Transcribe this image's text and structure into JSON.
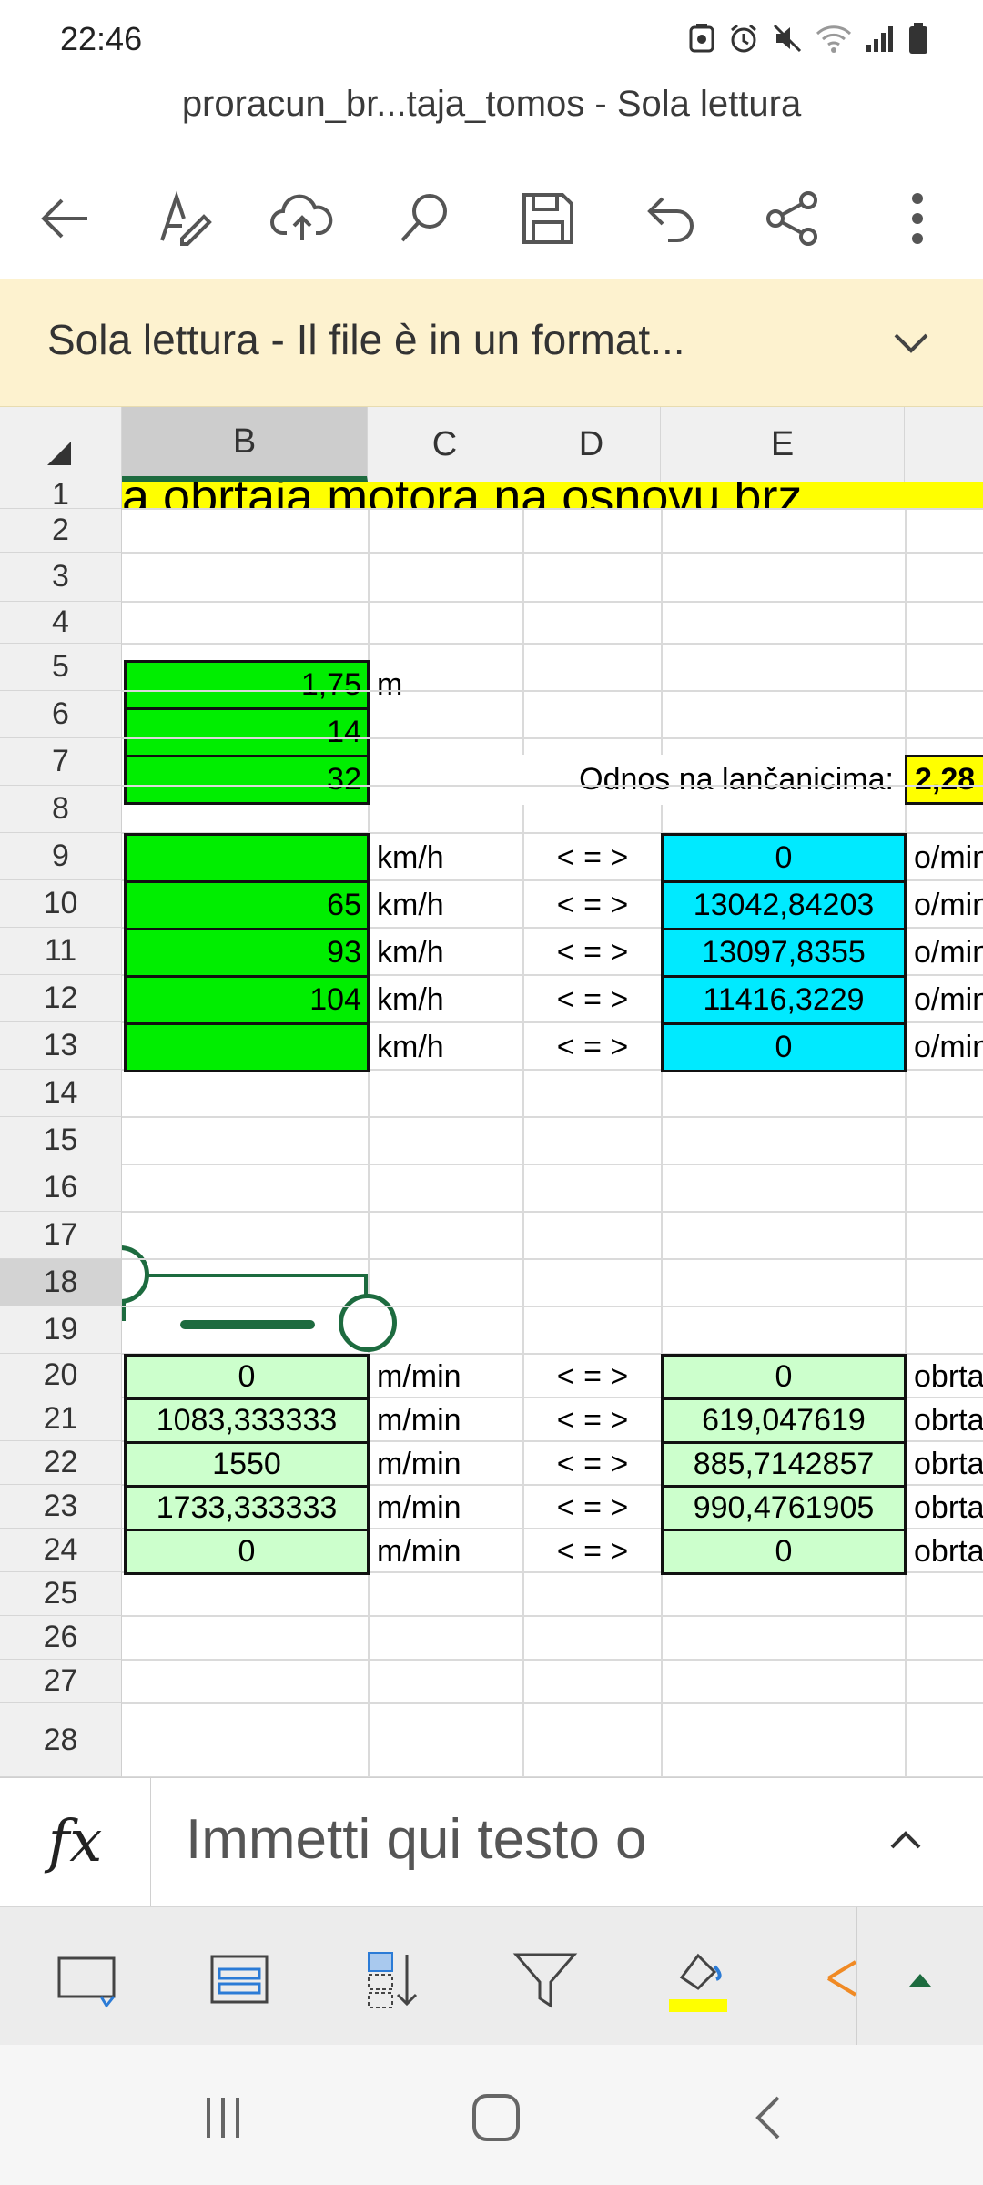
{
  "status_bar": {
    "time": "22:46"
  },
  "title": "proracun_br...taja_tomos - Sola lettura",
  "banner": {
    "text": "Sola lettura - Il file è in un format..."
  },
  "columns": [
    "B",
    "C",
    "D",
    "E"
  ],
  "rows": [
    "1",
    "2",
    "3",
    "4",
    "5",
    "6",
    "7",
    "8",
    "9",
    "10",
    "11",
    "12",
    "13",
    "14",
    "15",
    "16",
    "17",
    "18",
    "19",
    "20",
    "21",
    "22",
    "23",
    "24",
    "25",
    "26",
    "27",
    "28"
  ],
  "cells": {
    "r1_title": "a obrtaja motora na osnovu brz",
    "b5": "1,75",
    "c5": "m",
    "b6": "14",
    "b7": "32",
    "d7": "Odnos na lančanicima:",
    "f7": "2,28",
    "block1": [
      {
        "b": "",
        "c": "km/h",
        "d": "< = >",
        "e": "0",
        "f": "o/min"
      },
      {
        "b": "65",
        "c": "km/h",
        "d": "< = >",
        "e": "13042,84203",
        "f": "o/min"
      },
      {
        "b": "93",
        "c": "km/h",
        "d": "< = >",
        "e": "13097,8355",
        "f": "o/min"
      },
      {
        "b": "104",
        "c": "km/h",
        "d": "< = >",
        "e": "11416,3229",
        "f": "o/min"
      },
      {
        "b": "",
        "c": "km/h",
        "d": "< = >",
        "e": "0",
        "f": "o/min"
      }
    ],
    "block2": [
      {
        "b": "0",
        "c": "m/min",
        "d": "< = >",
        "e": "0",
        "f": "obrta"
      },
      {
        "b": "1083,333333",
        "c": "m/min",
        "d": "< = >",
        "e": "619,047619",
        "f": "obrta"
      },
      {
        "b": "1550",
        "c": "m/min",
        "d": "< = >",
        "e": "885,7142857",
        "f": "obrta"
      },
      {
        "b": "1733,333333",
        "c": "m/min",
        "d": "< = >",
        "e": "990,4761905",
        "f": "obrta"
      },
      {
        "b": "0",
        "c": "m/min",
        "d": "< = >",
        "e": "0",
        "f": "obrta"
      }
    ]
  },
  "formula_bar": {
    "fx": "fx",
    "placeholder": "Immetti qui testo o"
  },
  "colors": {
    "accent": "#1d6b3f",
    "banner": "#fdf2cf",
    "green": "#00ee00",
    "cyan": "#00eaff",
    "light_green": "#ccffcc",
    "yellow": "#ffff00"
  }
}
